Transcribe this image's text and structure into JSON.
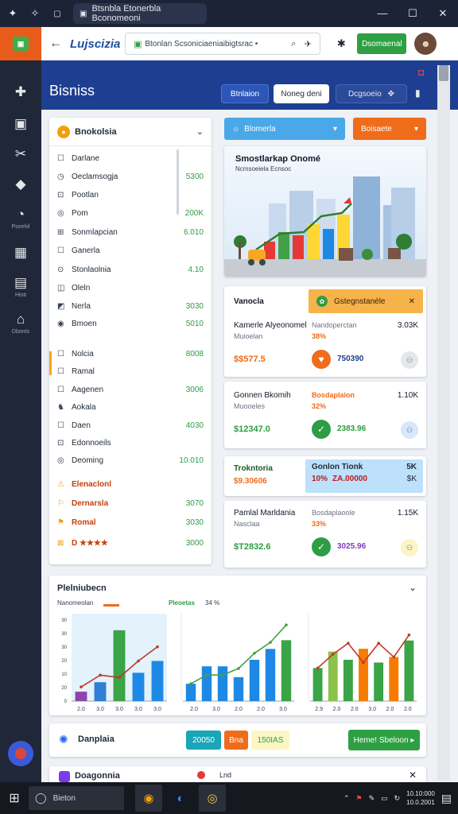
{
  "window": {
    "tab_title": "Btsnbla Etonerbla Bconomeoni",
    "minimize": "—",
    "maximize": "☐",
    "close": "✕"
  },
  "addressbar": {
    "brand": "Lujscizia",
    "url": "Btonlan Scsoniciaeniaibigtsrac •",
    "action_label": "Dsomaenal"
  },
  "sidebar": {
    "items": [
      {
        "icon": "puzzle-icon",
        "glyph": "✚",
        "label": ""
      },
      {
        "icon": "square-icon",
        "glyph": "▣",
        "label": ""
      },
      {
        "icon": "tools-icon",
        "glyph": "✂",
        "label": ""
      },
      {
        "icon": "tag-icon",
        "glyph": "◆",
        "label": ""
      },
      {
        "icon": "clock-icon",
        "glyph": "◔",
        "label": "Psoehil"
      },
      {
        "icon": "grid-icon",
        "glyph": "▦",
        "label": ""
      },
      {
        "icon": "chart-icon",
        "glyph": "▤",
        "label": "Hioti"
      },
      {
        "icon": "inbox-icon",
        "glyph": "⌂",
        "label": "Dbonts"
      }
    ]
  },
  "header": {
    "title": "Bisniss",
    "seg_a": "Btnlaion",
    "seg_b": "Noneg deni",
    "seg_c": "Dcgsoeio"
  },
  "left_panel": {
    "title": "Bnokolsia",
    "rows": [
      {
        "label": "Darlane",
        "value": "",
        "icon": "☐",
        "kind": "normal"
      },
      {
        "label": "Oeclamsogja",
        "value": "5300",
        "icon": "◷",
        "kind": "normal"
      },
      {
        "label": "Pootlan",
        "value": "",
        "icon": "⊡",
        "kind": "normal"
      },
      {
        "label": "Pom",
        "value": "200K",
        "icon": "◎",
        "kind": "normal"
      },
      {
        "label": "Sonmlapcian",
        "value": "6.010",
        "icon": "⊞",
        "kind": "normal"
      },
      {
        "label": "Ganerla",
        "value": "",
        "icon": "☐",
        "kind": "normal"
      },
      {
        "label": "Stonlaolnia",
        "value": "4.10",
        "icon": "⊙",
        "kind": "normal"
      },
      {
        "label": "Oleln",
        "value": "",
        "icon": "◫",
        "kind": "normal"
      },
      {
        "label": "Nerla",
        "value": "3030",
        "icon": "◩",
        "kind": "normal"
      },
      {
        "label": "Bmoen",
        "value": "5010",
        "icon": "◉",
        "kind": "normal"
      },
      {
        "label": "Nolcia",
        "value": "8008",
        "icon": "☐",
        "kind": "normal"
      },
      {
        "label": "Ramal",
        "value": "",
        "icon": "☐",
        "kind": "normal"
      },
      {
        "label": "Aagenen",
        "value": "3006",
        "icon": "☐",
        "kind": "normal"
      },
      {
        "label": "Aokala",
        "value": "",
        "icon": "♞",
        "kind": "normal"
      },
      {
        "label": "Daen",
        "value": "4030",
        "icon": "☐",
        "kind": "normal"
      },
      {
        "label": "Edonnoeils",
        "value": "",
        "icon": "⊡",
        "kind": "normal"
      },
      {
        "label": "Deoming",
        "value": "10.010",
        "icon": "◎",
        "kind": "normal"
      },
      {
        "label": "Elenaclonl",
        "value": "",
        "icon": "⚠",
        "kind": "warn"
      },
      {
        "label": "Dernarsla",
        "value": "3070",
        "icon": "⚐",
        "kind": "warn"
      },
      {
        "label": "Romal",
        "value": "3030",
        "icon": "⚑",
        "kind": "warn"
      },
      {
        "label": "D ★★★★",
        "value": "3000",
        "icon": "⊠",
        "kind": "warn"
      }
    ]
  },
  "dropdowns": {
    "blue": "Blomerla",
    "orange": "Boisaete"
  },
  "illustration": {
    "title": "Smostlarkap Onomé",
    "subtitle": "Ncmsoeiela Ecnsoc"
  },
  "cards": [
    {
      "banner_label": "Gstegnstanéle",
      "title": "Vanocla",
      "left_label": "Kamerle Alyeonomel",
      "left_sub": "Muioelan",
      "mid_label": "Nandoperctan",
      "mid_pct": "38%",
      "right_value": "3.03K",
      "amount": "$$577.5",
      "num": "750390",
      "bubble": "⚇"
    },
    {
      "title": "Gonnen Bkomih",
      "left_sub": "Muooeles",
      "mid_label": "Bosdaplaion",
      "mid_pct": "32%",
      "right_value": "1.10K",
      "amount": "$12347.0",
      "num": "2383.96",
      "bubble": "⚇"
    },
    {
      "title": "Trokntoria",
      "amount": "$9.30606",
      "banner_title": "Gonlon Tionk",
      "banner_value": "5K",
      "banner_pct": "10%",
      "banner_amt": "ZA.00000",
      "banner_right": "$K"
    },
    {
      "title": "Pamlal Marldania",
      "left_sub": "Nasclaa",
      "mid_label": "Bosdaplaoole",
      "mid_pct": "33%",
      "right_value": "1.15K",
      "amount": "$T2832.6",
      "num": "3025.96",
      "bubble": "⚇"
    }
  ],
  "chart_section": {
    "title": "Plelniubecn",
    "label_left": "Nanomeolan",
    "label_mid": "Pleoetas",
    "label_mid2": "34 %"
  },
  "chart_data": [
    {
      "type": "bar",
      "categories": [
        "2.0",
        "3.0",
        "3.0",
        "3.0",
        "3.0"
      ],
      "values": [
        4,
        8,
        30,
        12,
        17
      ],
      "line": [
        6,
        11,
        10,
        17,
        23
      ],
      "ylim": [
        0,
        35
      ],
      "yticks": [
        "30",
        "30",
        "30",
        "20",
        "10",
        "20",
        "0"
      ],
      "colors": [
        "#8e44ad",
        "#2f7fd3",
        "#3aa447",
        "#1e88e5",
        "#1e88e5"
      ]
    },
    {
      "type": "bar",
      "categories": [
        "2.0",
        "3.0",
        "2.0",
        "2.0",
        "3.0"
      ],
      "values": [
        8,
        16,
        16,
        11,
        19,
        24,
        28
      ],
      "line": [
        8,
        12,
        12,
        15,
        22,
        27,
        35
      ],
      "ylim": [
        0,
        38
      ],
      "colors": [
        "#1e88e5",
        "#1e88e5",
        "#1e88e5",
        "#1e88e5",
        "#1e88e5",
        "#1e88e5",
        "#3aa447"
      ]
    },
    {
      "type": "bar",
      "categories": [
        "2.9",
        "2.0",
        "2.0",
        "3.0",
        "2.0",
        "2.0"
      ],
      "values": [
        12,
        18,
        15,
        19,
        14,
        16,
        22
      ],
      "line": [
        12,
        17,
        21,
        14,
        21,
        16,
        24
      ],
      "ylim": [
        0,
        30
      ],
      "colors": [
        "#3aa447",
        "#8bc34a",
        "#3aa447",
        "#f57c00",
        "#3aa447",
        "#f57c00",
        "#3aa447"
      ]
    }
  ],
  "action_bar": {
    "title": "Danplaia",
    "chip_a": "20050",
    "chip_b": "Bna",
    "chip_c": "150IAS",
    "cta": "Heme! Sbeloon ▸"
  },
  "bottom_card": {
    "title": "Doagonnia",
    "subtitle": "Lnd"
  },
  "taskbar": {
    "search": "Bieton",
    "time": "10.10:000",
    "date": "10.0.2001"
  }
}
